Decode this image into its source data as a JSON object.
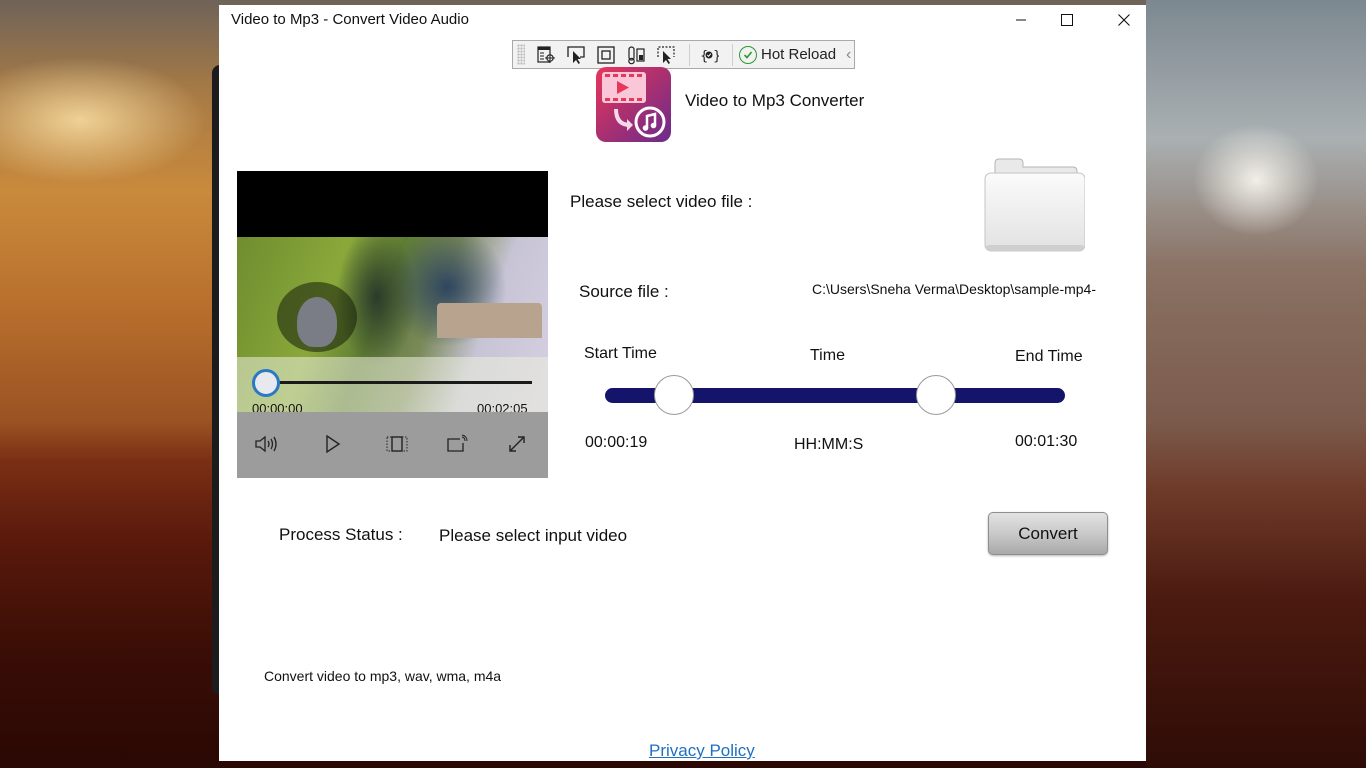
{
  "window": {
    "title": "Video to Mp3 - Convert Video Audio",
    "controls": {
      "minimize": "minimize-icon",
      "maximize": "maximize-icon",
      "close": "close-icon"
    }
  },
  "devtoolbar": {
    "icons": [
      "live-visual-tree-icon",
      "select-element-icon",
      "display-layout-adorners-icon",
      "track-focus-icon",
      "preview-selection-icon",
      "binding-failures-icon"
    ],
    "hot_reload_label": "Hot Reload",
    "hot_reload_status": "success",
    "collapse_icon": "chevron-left-icon"
  },
  "header": {
    "logo_icon": "video-to-music-icon",
    "title": "Video to Mp3 Converter"
  },
  "player": {
    "current_time": "00:00:00",
    "total_time": "00:02:05",
    "progress": 0,
    "controls": [
      "volume-icon",
      "play-icon",
      "aspect-ratio-icon",
      "cast-icon",
      "fullscreen-icon"
    ]
  },
  "file": {
    "select_label": "Please select video file :",
    "browse_icon": "folder-icon",
    "source_label": "Source file :",
    "source_value": "C:\\Users\\Sneha Verma\\Desktop\\sample-mp4-"
  },
  "trim": {
    "start_label": "Start Time",
    "time_label": "Time",
    "end_label": "End Time",
    "start_value": "00:00:19",
    "format_hint": "HH:MM:S",
    "end_value": "00:01:30",
    "start_fraction": 0.15,
    "end_fraction": 0.72,
    "track_color": "#14146b"
  },
  "status": {
    "label": "Process Status :",
    "value": "Please select input video"
  },
  "actions": {
    "convert_label": "Convert"
  },
  "footer": {
    "formats_text": "Convert video to  mp3, wav, wma, m4a",
    "privacy_link": "Privacy Policy",
    "link_color": "#2070c0"
  }
}
